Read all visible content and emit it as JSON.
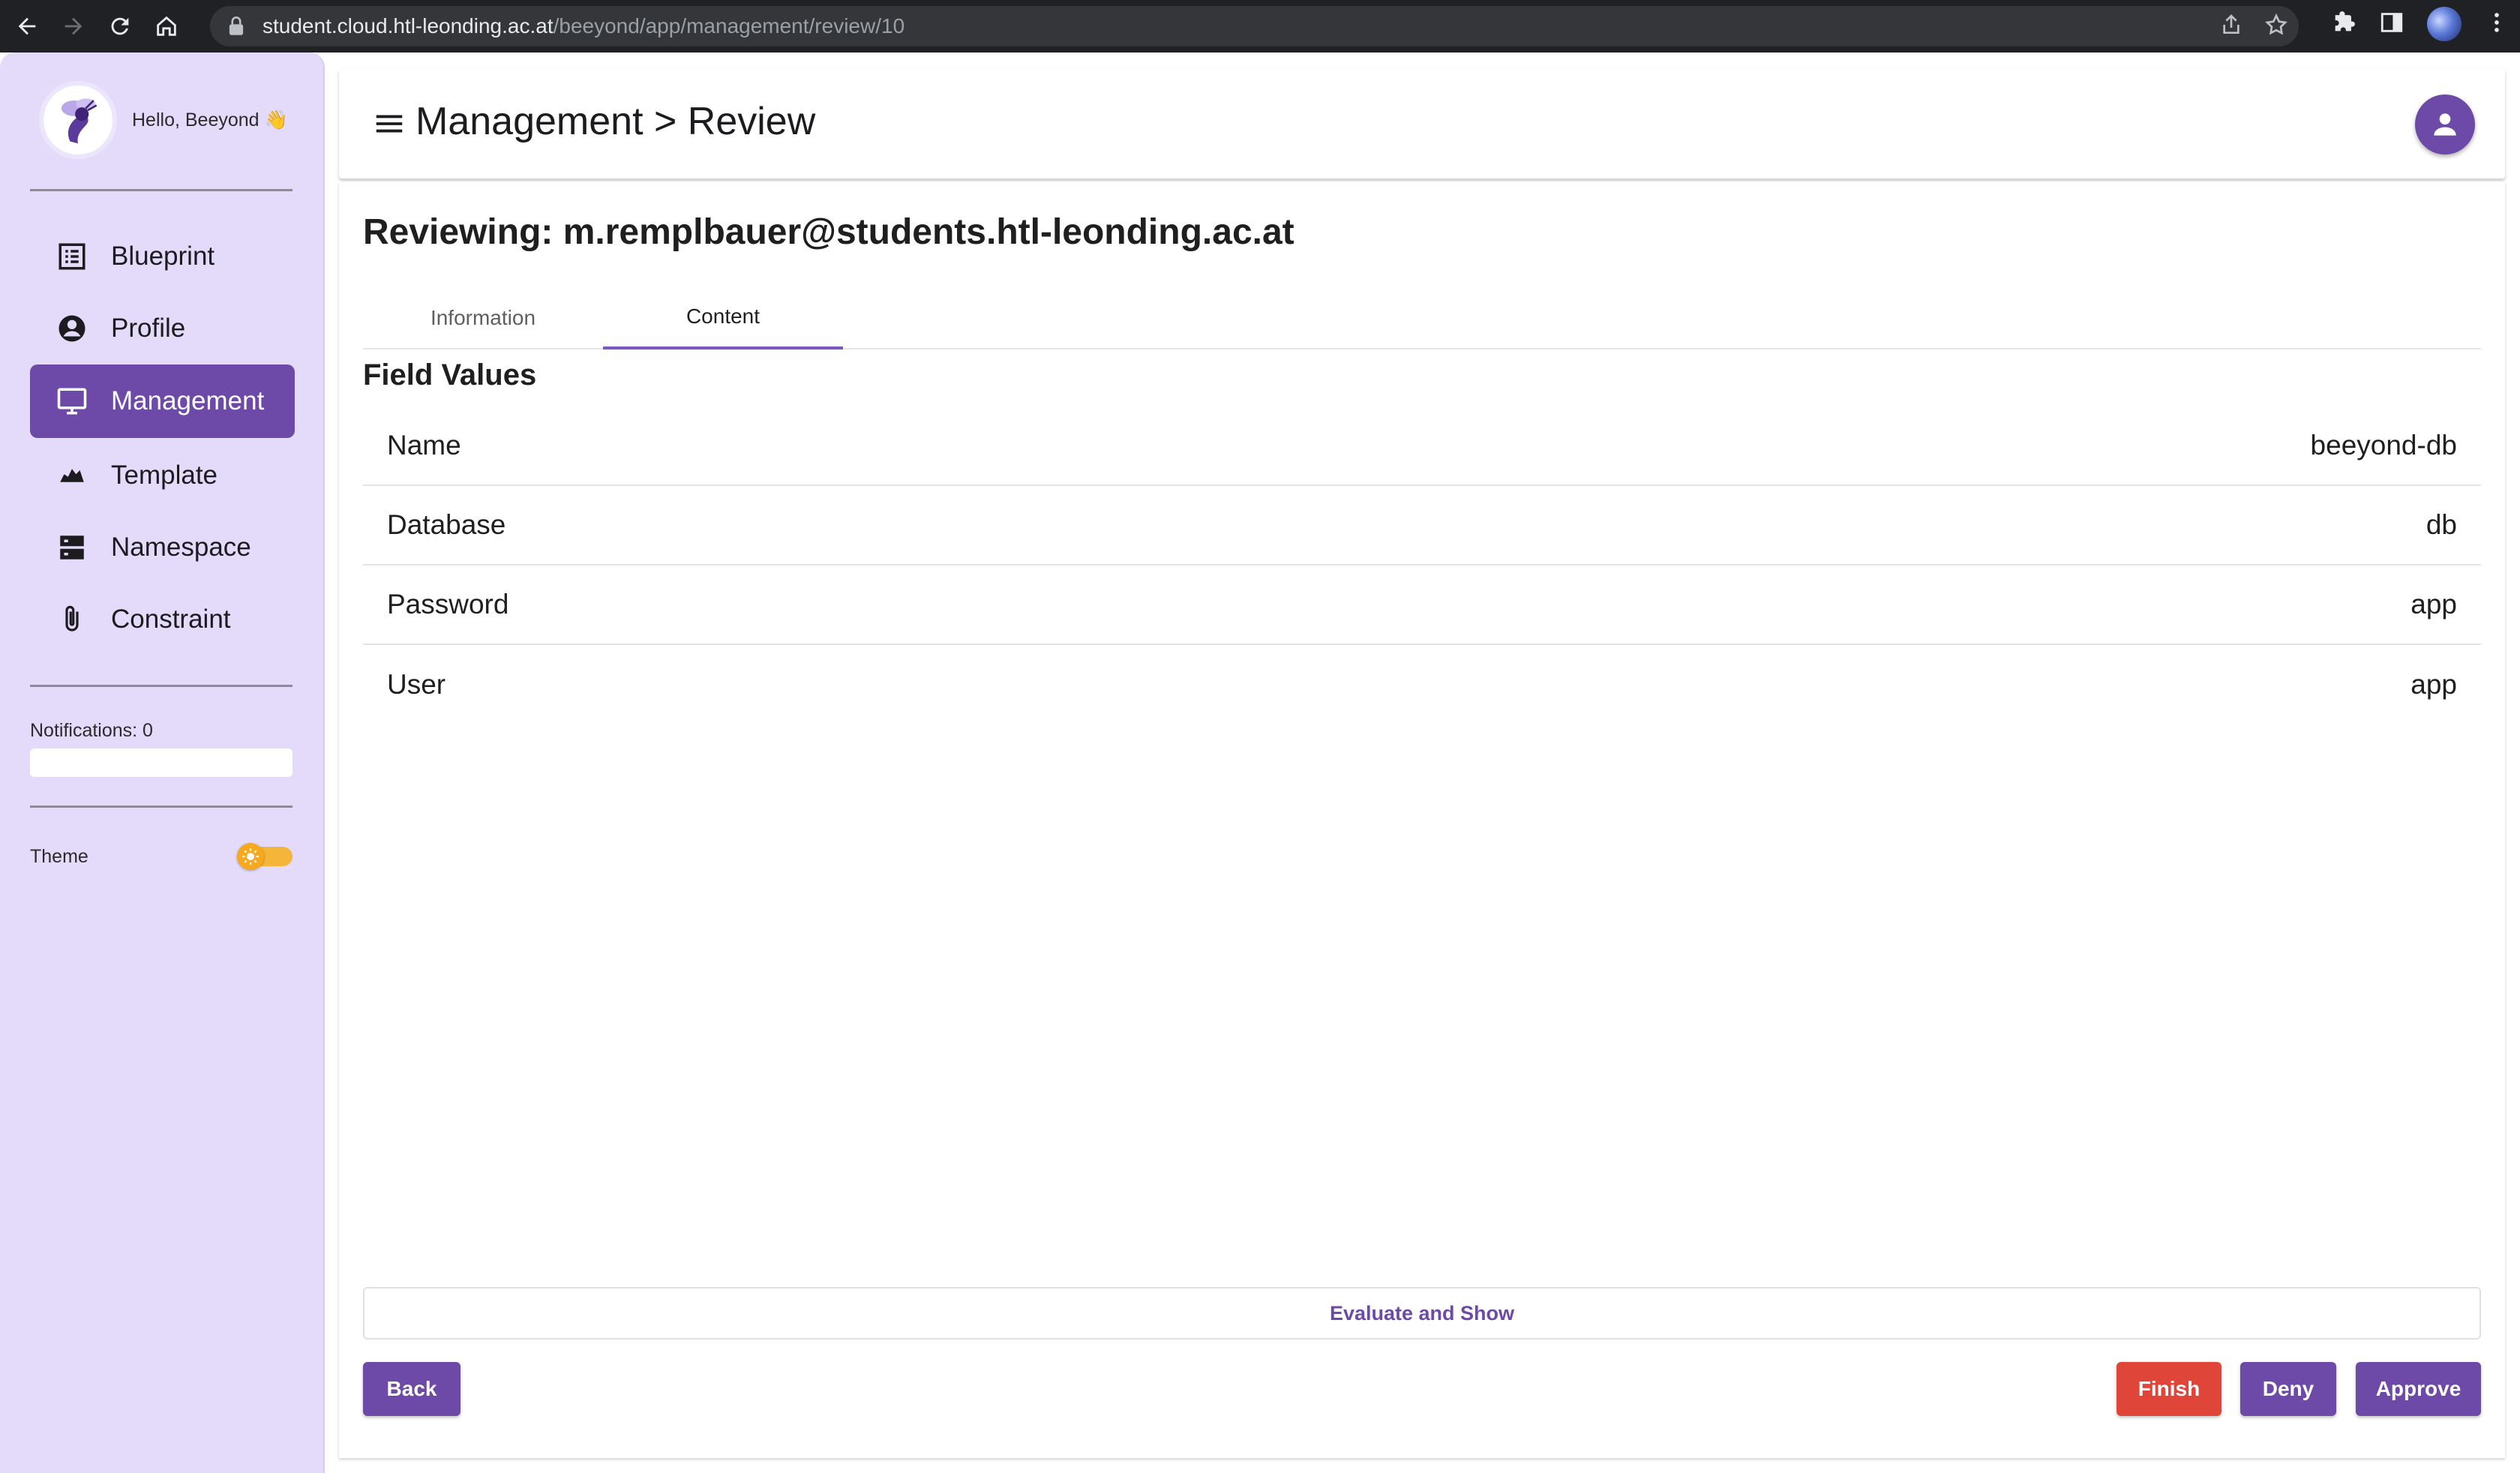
{
  "browser": {
    "url_host": "student.cloud.htl-leonding.ac.at",
    "url_path": "/beeyond/app/management/review/10"
  },
  "sidebar": {
    "greeting": "Hello, Beeyond 👋",
    "items": [
      {
        "label": "Blueprint",
        "icon": "list-alt-icon",
        "active": false
      },
      {
        "label": "Profile",
        "icon": "account-circle-icon",
        "active": false
      },
      {
        "label": "Management",
        "icon": "monitor-icon",
        "active": true
      },
      {
        "label": "Template",
        "icon": "template-icon",
        "active": false
      },
      {
        "label": "Namespace",
        "icon": "dns-icon",
        "active": false
      },
      {
        "label": "Constraint",
        "icon": "paperclip-icon",
        "active": false
      }
    ],
    "notifications_label": "Notifications: 0",
    "theme_label": "Theme"
  },
  "header": {
    "title": "Management > Review"
  },
  "review": {
    "title": "Reviewing: m.remplbauer@students.htl-leonding.ac.at",
    "tabs": [
      {
        "label": "Information",
        "active": false
      },
      {
        "label": "Content",
        "active": true
      }
    ],
    "field_values_title": "Field Values",
    "fields": [
      {
        "name": "Name",
        "value": "beeyond-db"
      },
      {
        "name": "Database",
        "value": "db"
      },
      {
        "name": "Password",
        "value": "app"
      },
      {
        "name": "User",
        "value": "app"
      }
    ],
    "evaluate_label": "Evaluate and Show",
    "back_label": "Back",
    "finish_label": "Finish",
    "deny_label": "Deny",
    "approve_label": "Approve"
  },
  "colors": {
    "accent": "#6d4aa8",
    "sidebar_bg": "#e4dbfb",
    "danger": "#e0453a",
    "toggle": "#f7a91e"
  }
}
